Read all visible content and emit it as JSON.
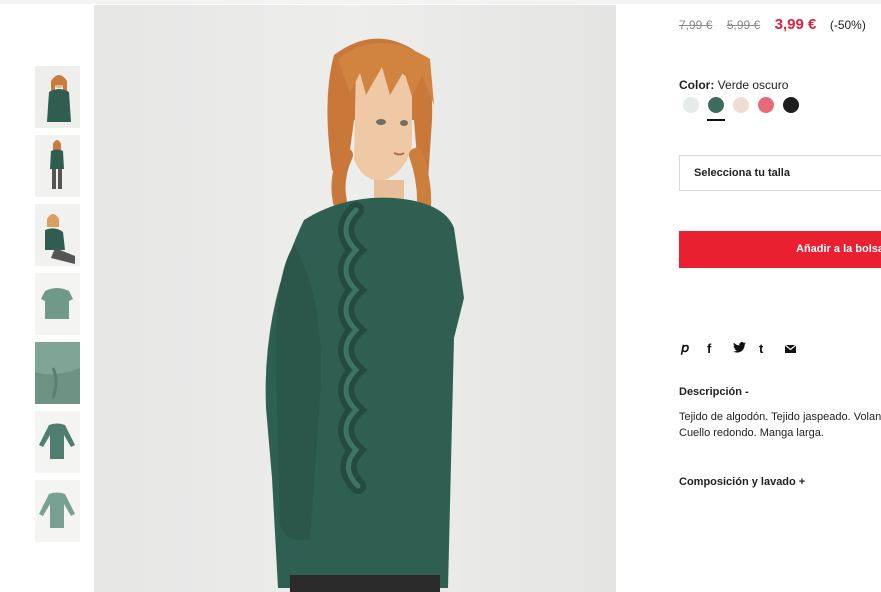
{
  "price": {
    "original_1": "7,99 €",
    "original_2": "5,99 €",
    "current": "3,99 €",
    "discount": "(-50%)",
    "sale_color": "#e2203b"
  },
  "color": {
    "label": "Color:",
    "value": "Verde oscuro",
    "swatches": [
      {
        "name": "light-grey",
        "hex": "#e6ebea",
        "selected": false
      },
      {
        "name": "dark-green",
        "hex": "#3e6b5e",
        "selected": true
      },
      {
        "name": "light-pink",
        "hex": "#f1dcd3",
        "selected": false
      },
      {
        "name": "coral-pink",
        "hex": "#e86a78",
        "selected": false
      },
      {
        "name": "black",
        "hex": "#1e1e1e",
        "selected": false
      }
    ]
  },
  "size": {
    "placeholder": "Selecciona tu talla"
  },
  "cart": {
    "label": "Añadir a la bolsa",
    "color": "#e8202f"
  },
  "share": {
    "icons": [
      {
        "name": "pinterest-icon",
        "glyph": "𝓅"
      },
      {
        "name": "facebook-icon",
        "glyph": "f"
      },
      {
        "name": "twitter-icon",
        "glyph": "🐦"
      },
      {
        "name": "tumblr-icon",
        "glyph": "t"
      },
      {
        "name": "mail-icon",
        "glyph": "✉"
      }
    ]
  },
  "description": {
    "title": "Descripción -",
    "line1": "Tejido de algodón. Tejido jaspeado. Volantes.",
    "line2": "Cuello redondo. Manga larga."
  },
  "composition": {
    "title": "Composición y lavado +"
  }
}
